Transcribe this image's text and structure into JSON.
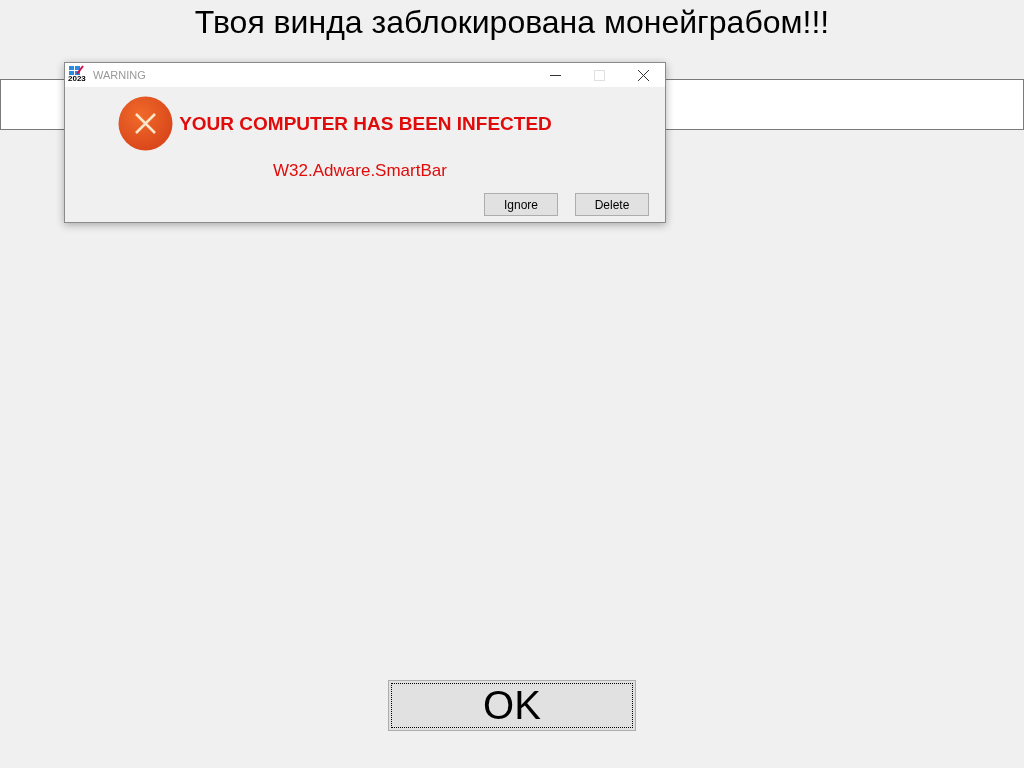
{
  "heading": "Твоя винда заблокирована монейграбом!!!",
  "input": {
    "kind": "text"
  },
  "dialog": {
    "title": "WARNING",
    "icon_label": "2023",
    "controls": [
      {
        "kind": "minimize",
        "disabled": false
      },
      {
        "kind": "maximize",
        "disabled": true
      },
      {
        "kind": "close",
        "disabled": false
      }
    ],
    "message": "YOUR COMPUTER HAS BEEN INFECTED",
    "threat": "W32.Adware.SmartBar",
    "buttons": [
      "Ignore",
      "Delete"
    ]
  },
  "ok_button": "OK"
}
